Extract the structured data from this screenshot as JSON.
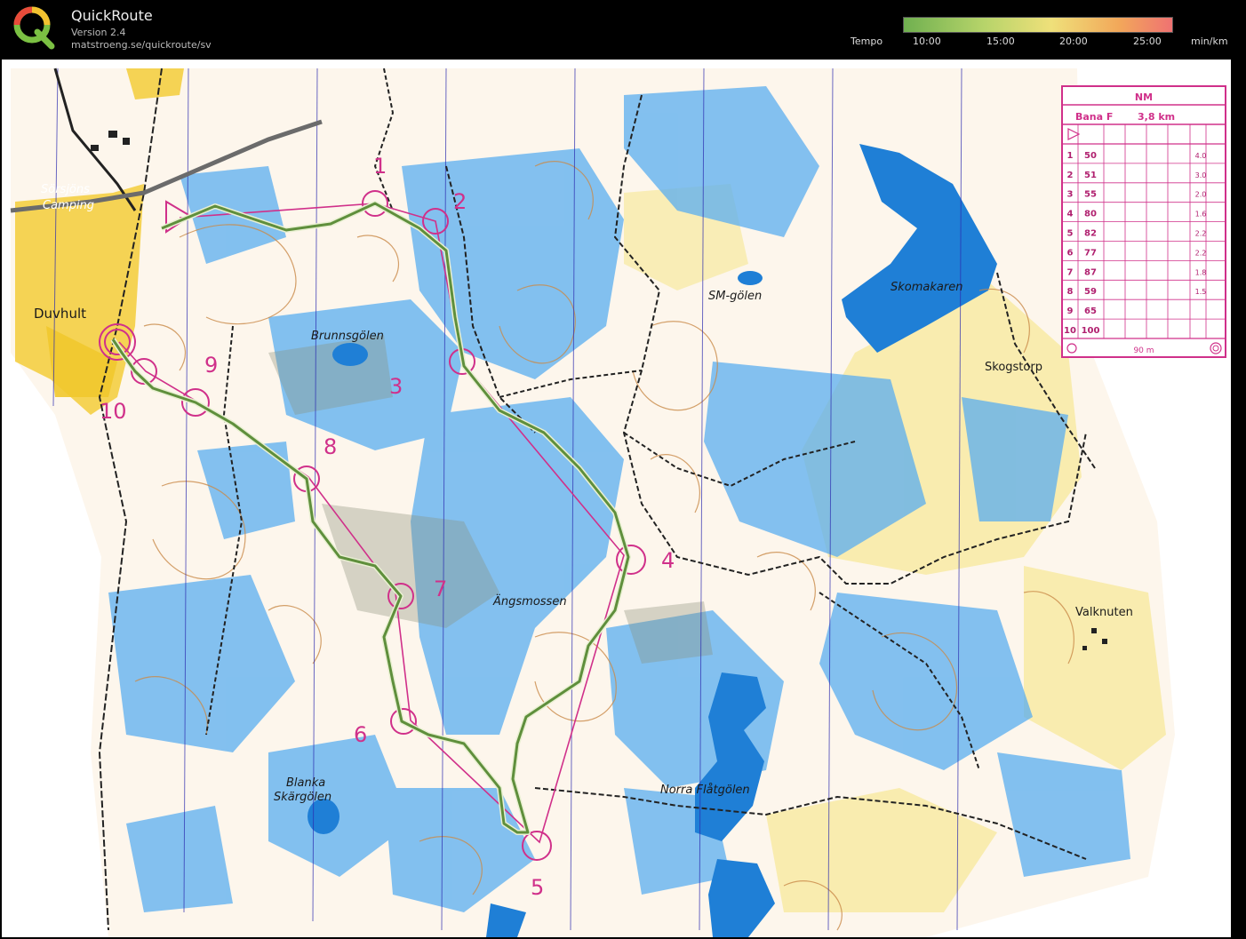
{
  "app": {
    "title": "QuickRoute",
    "version": "Version 2.4",
    "url": "matstroeng.se/quickroute/sv"
  },
  "tempo": {
    "label": "Tempo",
    "ticks": [
      "10:00",
      "15:00",
      "20:00",
      "25:00"
    ],
    "unit": "min/km"
  },
  "map": {
    "places": [
      "Sörsjöns",
      "Camping",
      "Duvhult",
      "Brunnsgölen",
      "SM-gölen",
      "Skomakaren",
      "Skogstorp",
      "Ängsmossen",
      "Valknuten",
      "Blanka",
      "Skärgölen",
      "Norra Flåtgölen"
    ],
    "control_numbers": [
      "1",
      "2",
      "3",
      "4",
      "5",
      "6",
      "7",
      "8",
      "9",
      "10"
    ]
  },
  "description_sheet": {
    "title": "NM",
    "course": "Bana F",
    "length": "3,8 km",
    "rows": [
      {
        "n": "1",
        "code": "50",
        "dist": "4.0"
      },
      {
        "n": "2",
        "code": "51",
        "dist": "3.0"
      },
      {
        "n": "3",
        "code": "55",
        "dist": "2.0"
      },
      {
        "n": "4",
        "code": "80",
        "dist": "1.6"
      },
      {
        "n": "5",
        "code": "82",
        "dist": "2.2"
      },
      {
        "n": "6",
        "code": "77",
        "dist": "2.2"
      },
      {
        "n": "7",
        "code": "87",
        "dist": "1.8"
      },
      {
        "n": "8",
        "code": "59",
        "dist": "1.5"
      },
      {
        "n": "9",
        "code": "65",
        "dist": ""
      },
      {
        "n": "10",
        "code": "100",
        "dist": ""
      }
    ],
    "finish_distance": "90 m"
  },
  "colors": {
    "course": "#d0308a",
    "route": "#5f8f3c",
    "water": "#1f7fd6",
    "marsh": "#4ea6e8",
    "open": "#f3d24a",
    "contour": "#c98a48"
  }
}
